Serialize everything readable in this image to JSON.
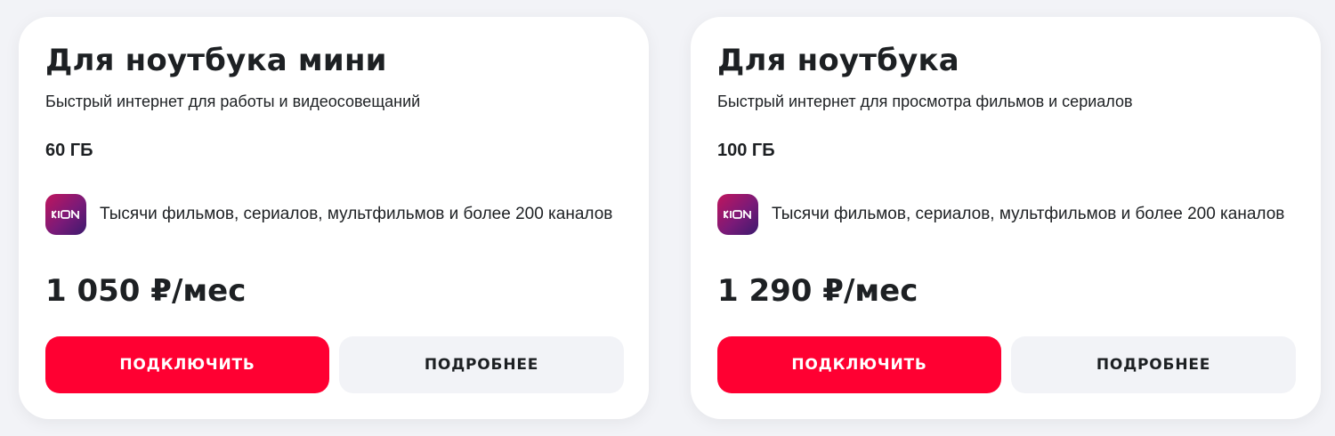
{
  "tariffs": [
    {
      "title": "Для ноутбука мини",
      "subtitle": "Быстрый интернет для работы и видеосовещаний",
      "volume": "60 ГБ",
      "service_logo": "KION",
      "service_text": "Тысячи фильмов, сериалов, мультфильмов и более 200 каналов",
      "price": "1 050 ₽/мес",
      "connect_label": "ПОДКЛЮЧИТЬ",
      "details_label": "ПОДРОБНЕЕ"
    },
    {
      "title": "Для ноутбука",
      "subtitle": "Быстрый интернет для просмотра фильмов и сериалов",
      "volume": "100 ГБ",
      "service_logo": "KION",
      "service_text": "Тысячи фильмов, сериалов, мультфильмов и более 200 каналов",
      "price": "1 290 ₽/мес",
      "connect_label": "ПОДКЛЮЧИТЬ",
      "details_label": "ПОДРОБНЕЕ"
    }
  ],
  "colors": {
    "accent": "#ff0032",
    "secondary_button": "#f2f3f7",
    "text": "#1d2023",
    "card": "#ffffff",
    "page_background": "#f2f3f7"
  }
}
